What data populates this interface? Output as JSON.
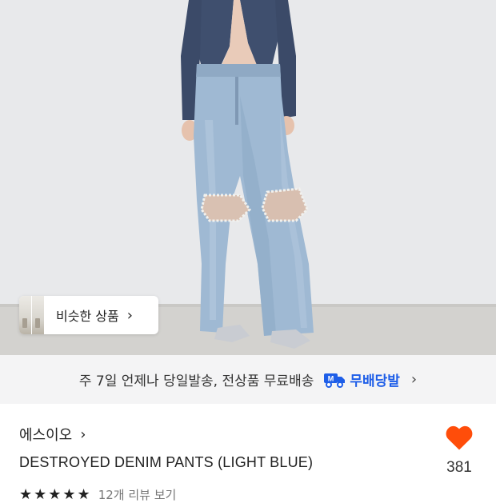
{
  "hero": {
    "image": "product-photo-destroyed-denim",
    "similar_products_label": "비슷한 상품",
    "similar_chevron": "›"
  },
  "shipping_banner": {
    "text": "주 7일 언제나 당일발송, 전상품 무료배송",
    "brand": "무배당발",
    "chevron": "›",
    "brand_color": "#1e5ee8"
  },
  "product": {
    "brand": "에스이오",
    "brand_chevron": "›",
    "title": "DESTROYED DENIM PANTS (LIGHT BLUE)",
    "likes": "381",
    "like_color": "#ff4d0a",
    "rating_stars": "★★★★★",
    "review_text": "12개 리뷰 보기"
  }
}
